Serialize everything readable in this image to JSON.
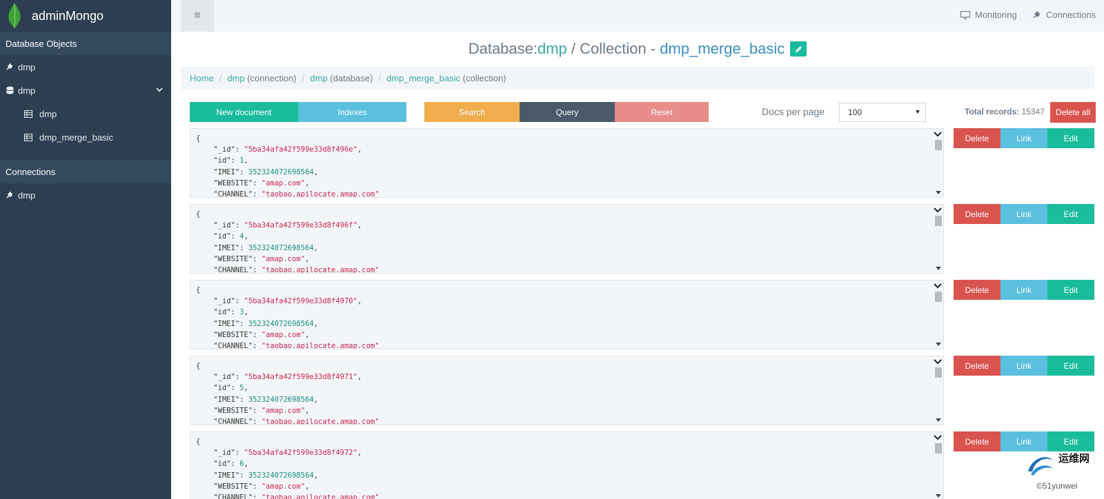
{
  "app": {
    "title": "adminMongo"
  },
  "sidebar": {
    "database_objects_label": "Database Objects",
    "connection_item": "dmp",
    "database_item": "dmp",
    "collections": [
      "dmp",
      "dmp_merge_basic"
    ],
    "connections_label": "Connections",
    "connections": [
      "dmp"
    ]
  },
  "topbar": {
    "menu_icon": "≡",
    "monitoring_label": "Monitoring",
    "connections_label": "Connections"
  },
  "heading": {
    "database_prefix": "Database: ",
    "database_name": "dmp",
    "collection_prefix": " / Collection - ",
    "collection_name": "dmp_merge_basic"
  },
  "breadcrumb": {
    "home": "Home",
    "conn_link": "dmp",
    "conn_suffix": " (connection)",
    "db_link": "dmp",
    "db_suffix": " (database)",
    "coll_link": "dmp_merge_basic",
    "coll_suffix": " (collection)"
  },
  "toolbar": {
    "new_document": "New document",
    "indexes": "Indexes",
    "search": "Search",
    "query": "Query",
    "reset": "Reset",
    "docs_per_page_label": "Docs per page",
    "docs_per_page_value": "100",
    "total_records_label": "Total records:",
    "total_records_value": "15347",
    "delete_all": "Delete all"
  },
  "documents": [
    {
      "_id": "\"5ba34afa42f599e33d8f496e\"",
      "id": "1",
      "IMEI": "352324072698564",
      "WEBSITE": "\"amap.com\"",
      "CHANNEL": "\"taobao.apilocate.amap.com\""
    },
    {
      "_id": "\"5ba34afa42f599e33d8f496f\"",
      "id": "4",
      "IMEI": "352324072698564",
      "WEBSITE": "\"amap.com\"",
      "CHANNEL": "\"taobao.apilocate.amap.com\""
    },
    {
      "_id": "\"5ba34afa42f599e33d8f4970\"",
      "id": "3",
      "IMEI": "352324072698564",
      "WEBSITE": "\"amap.com\"",
      "CHANNEL": "\"taobao.apilocate.amap.com\""
    },
    {
      "_id": "\"5ba34afa42f599e33d8f4971\"",
      "id": "5",
      "IMEI": "352324072698564",
      "WEBSITE": "\"amap.com\"",
      "CHANNEL": "\"taobao.apilocate.amap.com\""
    },
    {
      "_id": "\"5ba34afa42f599e33d8f4972\"",
      "id": "6",
      "IMEI": "352324072698564",
      "WEBSITE": "\"amap.com\"",
      "CHANNEL": "\"taobao.apilocate.amap.com\""
    }
  ],
  "doc_keys": {
    "open_brace": "{",
    "_id": "\"_id\"",
    "id": "\"id\"",
    "IMEI": "\"IMEI\"",
    "WEBSITE": "\"WEBSITE\"",
    "CHANNEL": "\"CHANNEL\""
  },
  "doc_actions": {
    "delete": "Delete",
    "link": "Link",
    "edit": "Edit"
  },
  "watermark": {
    "cn": "运维网",
    "en": "©51yunwei"
  },
  "colors": {
    "sidebar": "#2c3e50",
    "teal": "#1abc9c",
    "info": "#5bc0de",
    "danger": "#d9534f",
    "warning": "#f0ad4e",
    "dark": "#4a5a6b"
  }
}
